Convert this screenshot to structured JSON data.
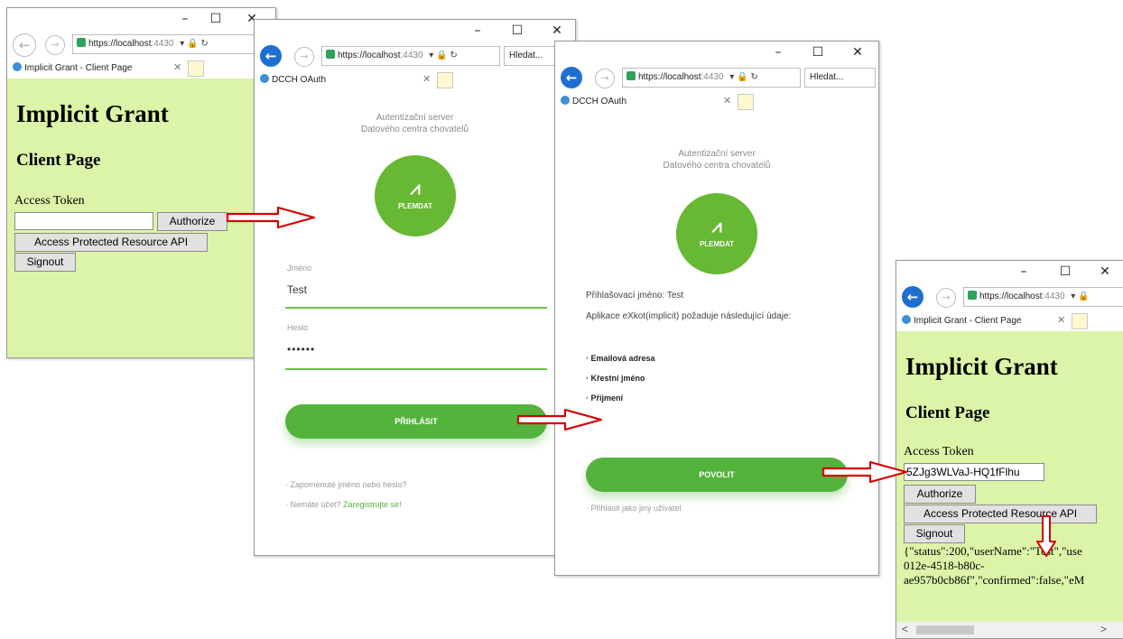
{
  "browser": {
    "url_scheme": "https://",
    "url_host": "localhost",
    "url_port": "4430",
    "search_label": "Hledat..."
  },
  "client_window_1": {
    "tab_title": "Implicit Grant - Client Page",
    "heading": "Implicit Grant",
    "subheading": "Client Page",
    "token_label": "Access Token",
    "token_value": "",
    "authorize_label": "Authorize",
    "api_label": "Access Protected Resource API",
    "signout_label": "Signout"
  },
  "login_window": {
    "tab_title": "DCCH OAuth",
    "server_title_line1": "Autentizační server",
    "server_title_line2": "Datového centra chovatelů",
    "logo_text": "PLEMDAT",
    "username_label": "Jméno",
    "username_value": "Test",
    "password_label": "Heslo",
    "password_value": "••••••",
    "login_button": "PŘIHLÁSIT",
    "forgot_link": "Zapomenuté jméno nebo heslo?",
    "no_account_text": "Nemáte účet?",
    "register_link": "Zaregistrujte se!"
  },
  "consent_window": {
    "tab_title": "DCCH OAuth",
    "server_title_line1": "Autentizační server",
    "server_title_line2": "Datového centra chovatelů",
    "logo_text": "PLEMDAT",
    "login_name_text": "Přihlašovací jméno: Test",
    "request_text": "Aplikace eXkot(implicit) požaduje následující údaje:",
    "scopes": [
      "Emailová adresa",
      "Křestní jméno",
      "Příjmení"
    ],
    "allow_button": "POVOLIT",
    "other_user_link": "Přihlásit jako jiný uživatel"
  },
  "client_window_2": {
    "tab_title": "Implicit Grant - Client Page",
    "heading": "Implicit Grant",
    "subheading": "Client Page",
    "token_label": "Access Token",
    "token_value": "5ZJg3WLVaJ-HQ1fFlhu",
    "authorize_label": "Authorize",
    "api_label": "Access Protected Resource API",
    "signout_label": "Signout",
    "response_line1": "{\"status\":200,\"userName\":\"Test\",\"use",
    "response_line2": "012e-4518-b80c-",
    "response_line3": "ae957b0cb86f\",\"confirmed\":false,\"eM"
  },
  "colors": {
    "client_bg": "#dcf4a8",
    "brand_green": "#54b33d",
    "arrow_red": "#d40000",
    "ie_blue": "#1f6fd1"
  }
}
